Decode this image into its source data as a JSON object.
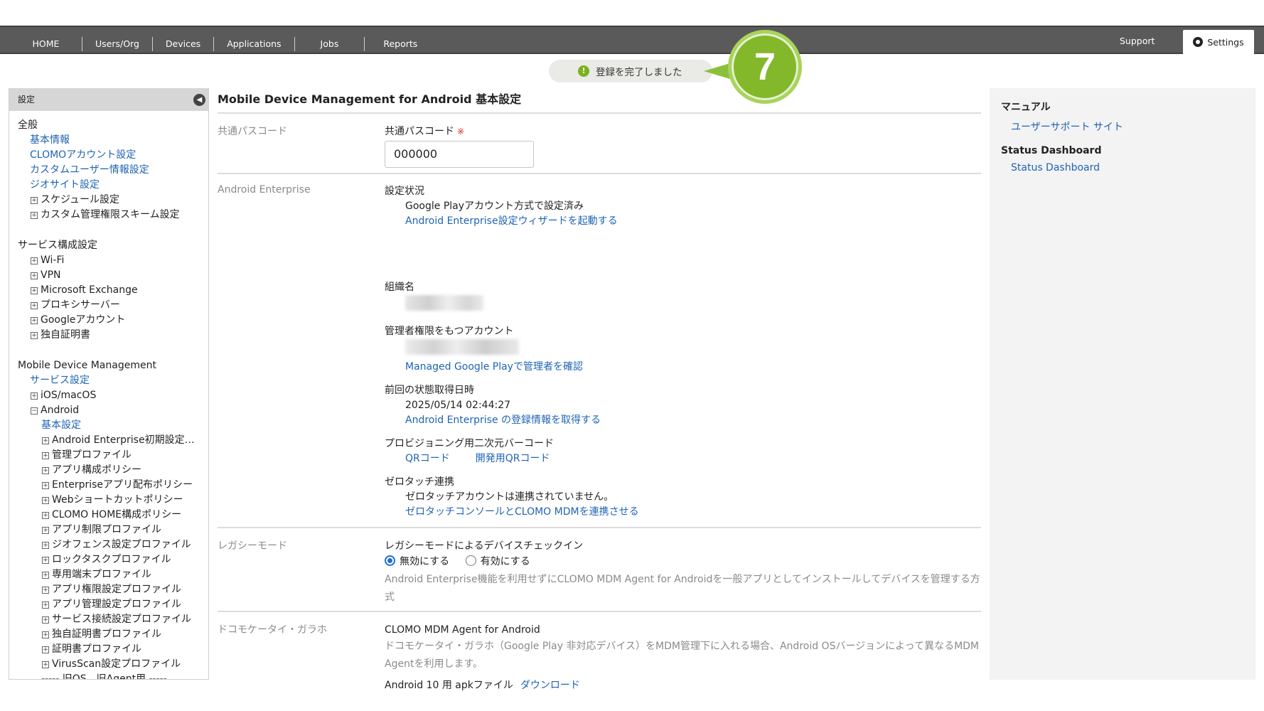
{
  "nav": {
    "items": [
      "HOME",
      "Users/Org",
      "Devices",
      "Applications",
      "Jobs",
      "Reports"
    ],
    "support": "Support",
    "settings": "Settings"
  },
  "toast": {
    "icon": "alert-icon",
    "text": "登録を完了しました"
  },
  "callout": {
    "number": "7"
  },
  "sidebar": {
    "title": "設定",
    "general": {
      "heading": "全般",
      "links": [
        "基本情報",
        "CLOMOアカウント設定",
        "カスタムユーザー情報設定",
        "ジオサイト設定"
      ],
      "expandables": [
        "スケジュール設定",
        "カスタム管理権限スキーム設定"
      ]
    },
    "services": {
      "heading": "サービス構成設定",
      "expandables": [
        "Wi-Fi",
        "VPN",
        "Microsoft Exchange",
        "プロキシサーバー",
        "Googleアカウント",
        "独自証明書"
      ]
    },
    "mdm": {
      "heading": "Mobile Device Management",
      "service_link": "サービス設定",
      "ios": "iOS/macOS",
      "android": "Android",
      "android_basic": "基本設定",
      "android_items": [
        "Android Enterprise初期設定…",
        "管理プロファイル",
        "アプリ構成ポリシー",
        "Enterpriseアプリ配布ポリシー",
        "Webショートカットポリシー",
        "CLOMO HOME構成ポリシー",
        "アプリ制限プロファイル",
        "ジオフェンス設定プロファイル",
        "ロックタスクプロファイル",
        "専用端末プロファイル",
        "アプリ権限設定プロファイル",
        "アプリ管理設定プロファイル",
        "サービス接続設定プロファイル",
        "独自証明書プロファイル",
        "証明書プロファイル",
        "VirusScan設定プロファイル"
      ],
      "separator": "----- 旧OS、旧Agent用 -----"
    }
  },
  "main": {
    "title": "Mobile Device Management for Android 基本設定",
    "passcode": {
      "label": "共通パスコード",
      "field_label": "共通パスコード",
      "required_mark": "※",
      "value": "000000"
    },
    "enterprise": {
      "label": "Android Enterprise",
      "status_heading": "設定状況",
      "status_value": "Google Playアカウント方式で設定済み",
      "wizard_link": "Android Enterprise設定ウィザードを起動する",
      "org_heading": "組織名",
      "admin_heading": "管理者権限をもつアカウント",
      "admin_link": "Managed Google Playで管理者を確認",
      "last_heading": "前回の状態取得日時",
      "last_value": "2025/05/14 02:44:27",
      "last_link": "Android Enterprise の登録情報を取得する",
      "qr_heading": "プロビジョニング用二次元バーコード",
      "qr_link": "QRコード",
      "dev_qr_link": "開発用QRコード",
      "zt_heading": "ゼロタッチ連携",
      "zt_value": "ゼロタッチアカウントは連携されていません。",
      "zt_link": "ゼロタッチコンソールとCLOMO MDMを連携させる"
    },
    "legacy": {
      "label": "レガシーモード",
      "heading": "レガシーモードによるデバイスチェックイン",
      "option_off": "無効にする",
      "option_on": "有効にする",
      "selected": "無効にする",
      "note": "Android Enterprise機能を利用せずにCLOMO MDM Agent for Androidを一般アプリとしてインストールしてデバイスを管理する方式"
    },
    "docomo": {
      "label": "ドコモケータイ・ガラホ",
      "heading": "CLOMO MDM Agent for Android",
      "note": "ドコモケータイ・ガラホ（Google Play 非対応デバイス）をMDM管理下に入れる場合、Android OSバージョンによって異なるMDM Agentを利用します。",
      "apk_label": "Android 10 用 apkファイル",
      "download": "ダウンロード"
    }
  },
  "right": {
    "manual_heading": "マニュアル",
    "manual_link": "ユーザーサポート サイト",
    "status_heading": "Status Dashboard",
    "status_link": "Status Dashboard"
  }
}
